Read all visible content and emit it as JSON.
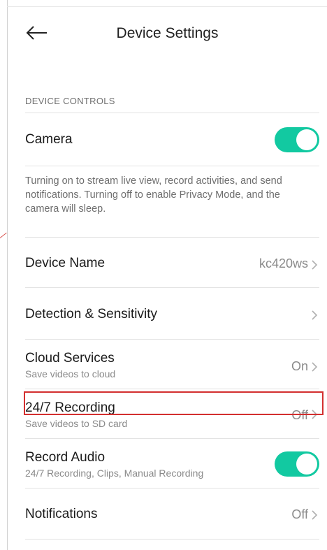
{
  "header": {
    "title": "Device Settings"
  },
  "section": {
    "label": "DEVICE CONTROLS"
  },
  "camera": {
    "label": "Camera",
    "toggle_on": true,
    "description": "Turning on to stream live view, record activities, and send notifications. Turning off to enable Privacy Mode, and the camera will sleep."
  },
  "device_name": {
    "label": "Device Name",
    "value": "kc420ws"
  },
  "detection": {
    "label": "Detection & Sensitivity"
  },
  "cloud": {
    "label": "Cloud Services",
    "sub": "Save videos to cloud",
    "value": "On"
  },
  "recording": {
    "label": "24/7 Recording",
    "sub": "Save videos to SD card",
    "value": "Off"
  },
  "record_audio": {
    "label": "Record Audio",
    "sub": "24/7 Recording, Clips, Manual Recording",
    "toggle_on": true
  },
  "notifications": {
    "label": "Notifications",
    "value": "Off"
  },
  "colors": {
    "accent": "#12c9a1",
    "highlight": "#d32f2f"
  }
}
